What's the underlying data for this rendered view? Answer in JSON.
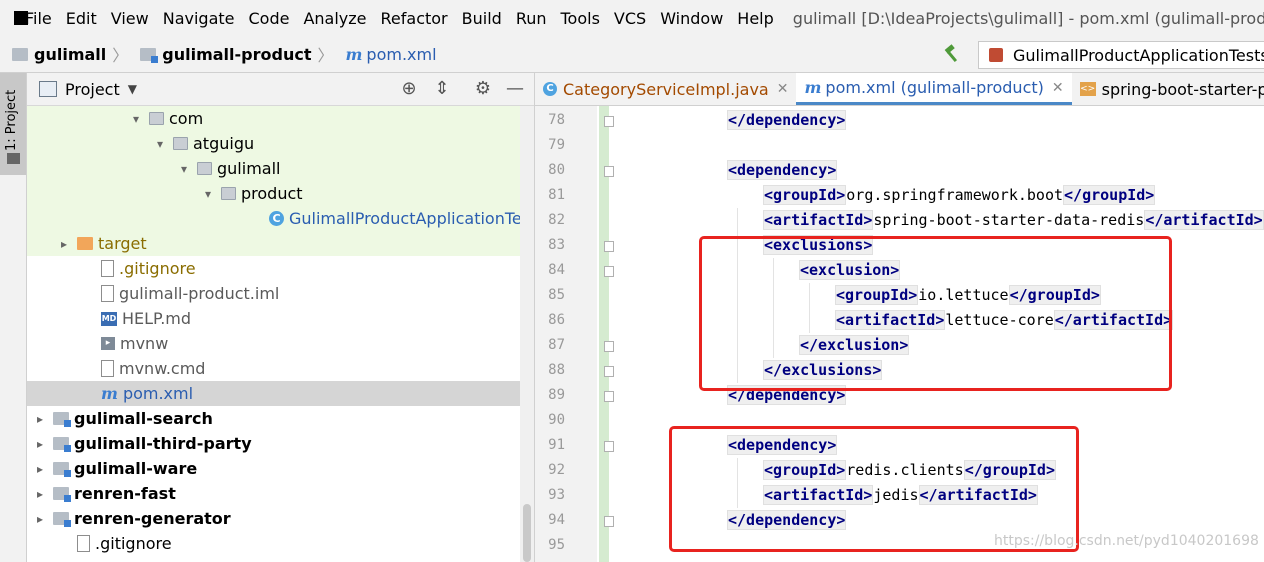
{
  "menu": {
    "items": [
      "File",
      "Edit",
      "View",
      "Navigate",
      "Code",
      "Analyze",
      "Refactor",
      "Build",
      "Run",
      "Tools",
      "VCS",
      "Window",
      "Help"
    ],
    "window_title": "gulimall [D:\\IdeaProjects\\gulimall] - pom.xml (gulimall-product) - I"
  },
  "nav": {
    "crumbs": [
      "gulimall",
      "gulimall-product",
      "pom.xml"
    ],
    "run_config": "GulimallProductApplicationTests"
  },
  "tool_strip": {
    "project_tab": "1: Project"
  },
  "project_panel": {
    "title": "Project",
    "tree": [
      {
        "label": "com",
        "icon": "package-icon",
        "arrow": "▾",
        "indent": 4,
        "style": ""
      },
      {
        "label": "atguigu",
        "icon": "package-icon",
        "arrow": "▾",
        "indent": 5,
        "style": ""
      },
      {
        "label": "gulimall",
        "icon": "package-icon",
        "arrow": "▾",
        "indent": 6,
        "style": ""
      },
      {
        "label": "product",
        "icon": "package-icon",
        "arrow": "▾",
        "indent": 7,
        "style": ""
      },
      {
        "label": "GulimallProductApplicationTests",
        "icon": "class-icon",
        "arrow": "",
        "indent": 9,
        "style": "blue"
      },
      {
        "label": "target",
        "icon": "folder-orange-icon",
        "arrow": "▸",
        "indent": 1,
        "style": "olive"
      },
      {
        "label": ".gitignore",
        "icon": "file-icon",
        "arrow": "",
        "indent": 2,
        "style": "olive"
      },
      {
        "label": "gulimall-product.iml",
        "icon": "file-icon",
        "arrow": "",
        "indent": 2,
        "style": "gray"
      },
      {
        "label": "HELP.md",
        "icon": "markdown-icon",
        "arrow": "",
        "indent": 2,
        "style": "gray"
      },
      {
        "label": "mvnw",
        "icon": "script-icon",
        "arrow": "",
        "indent": 2,
        "style": "gray"
      },
      {
        "label": "mvnw.cmd",
        "icon": "file-icon",
        "arrow": "",
        "indent": 2,
        "style": "gray"
      },
      {
        "label": "pom.xml",
        "icon": "maven-icon",
        "arrow": "",
        "indent": 2,
        "style": "blue"
      },
      {
        "label": "gulimall-search",
        "icon": "module-folder-icon",
        "arrow": "▸",
        "indent": 0,
        "style": "bold"
      },
      {
        "label": "gulimall-third-party",
        "icon": "module-folder-icon",
        "arrow": "▸",
        "indent": 0,
        "style": "bold"
      },
      {
        "label": "gulimall-ware",
        "icon": "module-folder-icon",
        "arrow": "▸",
        "indent": 0,
        "style": "bold"
      },
      {
        "label": "renren-fast",
        "icon": "module-folder-icon",
        "arrow": "▸",
        "indent": 0,
        "style": "bold"
      },
      {
        "label": "renren-generator",
        "icon": "module-folder-icon",
        "arrow": "▸",
        "indent": 0,
        "style": "bold"
      },
      {
        "label": ".gitignore",
        "icon": "file-icon",
        "arrow": "",
        "indent": 1,
        "style": ""
      }
    ]
  },
  "editor": {
    "tabs": [
      {
        "label": "CategoryServiceImpl.java",
        "icon": "class-icon",
        "active": false,
        "closable": true,
        "style": "orange"
      },
      {
        "label": "pom.xml (gulimall-product)",
        "icon": "maven-icon",
        "active": true,
        "closable": true,
        "style": "blue"
      },
      {
        "label": "spring-boot-starter-parent",
        "icon": "parent-pom-icon",
        "active": false,
        "closable": false,
        "style": ""
      }
    ],
    "lines": [
      {
        "no": "78",
        "indent": 1,
        "segs": [
          [
            "tag",
            "</dependency>"
          ]
        ]
      },
      {
        "no": "79",
        "indent": 0,
        "segs": []
      },
      {
        "no": "80",
        "indent": 1,
        "segs": [
          [
            "tag",
            "<dependency>"
          ]
        ]
      },
      {
        "no": "81",
        "indent": 2,
        "segs": [
          [
            "tag",
            "<groupId>"
          ],
          [
            "text",
            "org.springframework.boot"
          ],
          [
            "tag",
            "</groupId>"
          ]
        ]
      },
      {
        "no": "82",
        "indent": 2,
        "segs": [
          [
            "tag",
            "<artifactId>"
          ],
          [
            "text",
            "spring-boot-starter-data-redis"
          ],
          [
            "tag",
            "</artifactId>"
          ]
        ]
      },
      {
        "no": "83",
        "indent": 2,
        "segs": [
          [
            "tag",
            "<exclusions>"
          ]
        ]
      },
      {
        "no": "84",
        "indent": 3,
        "segs": [
          [
            "tag",
            "<exclusion>"
          ]
        ]
      },
      {
        "no": "85",
        "indent": 4,
        "segs": [
          [
            "tag",
            "<groupId>"
          ],
          [
            "text",
            "io.lettuce"
          ],
          [
            "tag",
            "</groupId>"
          ]
        ]
      },
      {
        "no": "86",
        "indent": 4,
        "segs": [
          [
            "tag",
            "<artifactId>"
          ],
          [
            "text",
            "lettuce-core"
          ],
          [
            "tag",
            "</artifactId>"
          ]
        ]
      },
      {
        "no": "87",
        "indent": 3,
        "segs": [
          [
            "tag",
            "</exclusion>"
          ]
        ]
      },
      {
        "no": "88",
        "indent": 2,
        "segs": [
          [
            "tag",
            "</exclusions>"
          ]
        ]
      },
      {
        "no": "89",
        "indent": 1,
        "segs": [
          [
            "tag",
            "</dependency>"
          ]
        ]
      },
      {
        "no": "90",
        "indent": 0,
        "segs": []
      },
      {
        "no": "91",
        "indent": 1,
        "segs": [
          [
            "tag",
            "<dependency>"
          ]
        ]
      },
      {
        "no": "92",
        "indent": 2,
        "segs": [
          [
            "tag",
            "<groupId>"
          ],
          [
            "text",
            "redis.clients"
          ],
          [
            "tag",
            "</groupId>"
          ]
        ]
      },
      {
        "no": "93",
        "indent": 2,
        "segs": [
          [
            "tag",
            "<artifactId>"
          ],
          [
            "text",
            "jedis"
          ],
          [
            "tag",
            "</artifactId>"
          ]
        ]
      },
      {
        "no": "94",
        "indent": 1,
        "segs": [
          [
            "tag",
            "</dependency>"
          ]
        ]
      },
      {
        "no": "95",
        "indent": 0,
        "segs": []
      }
    ],
    "annotation_color": "#e8231f"
  },
  "watermark": "https://blog.csdn.net/pyd1040201698"
}
